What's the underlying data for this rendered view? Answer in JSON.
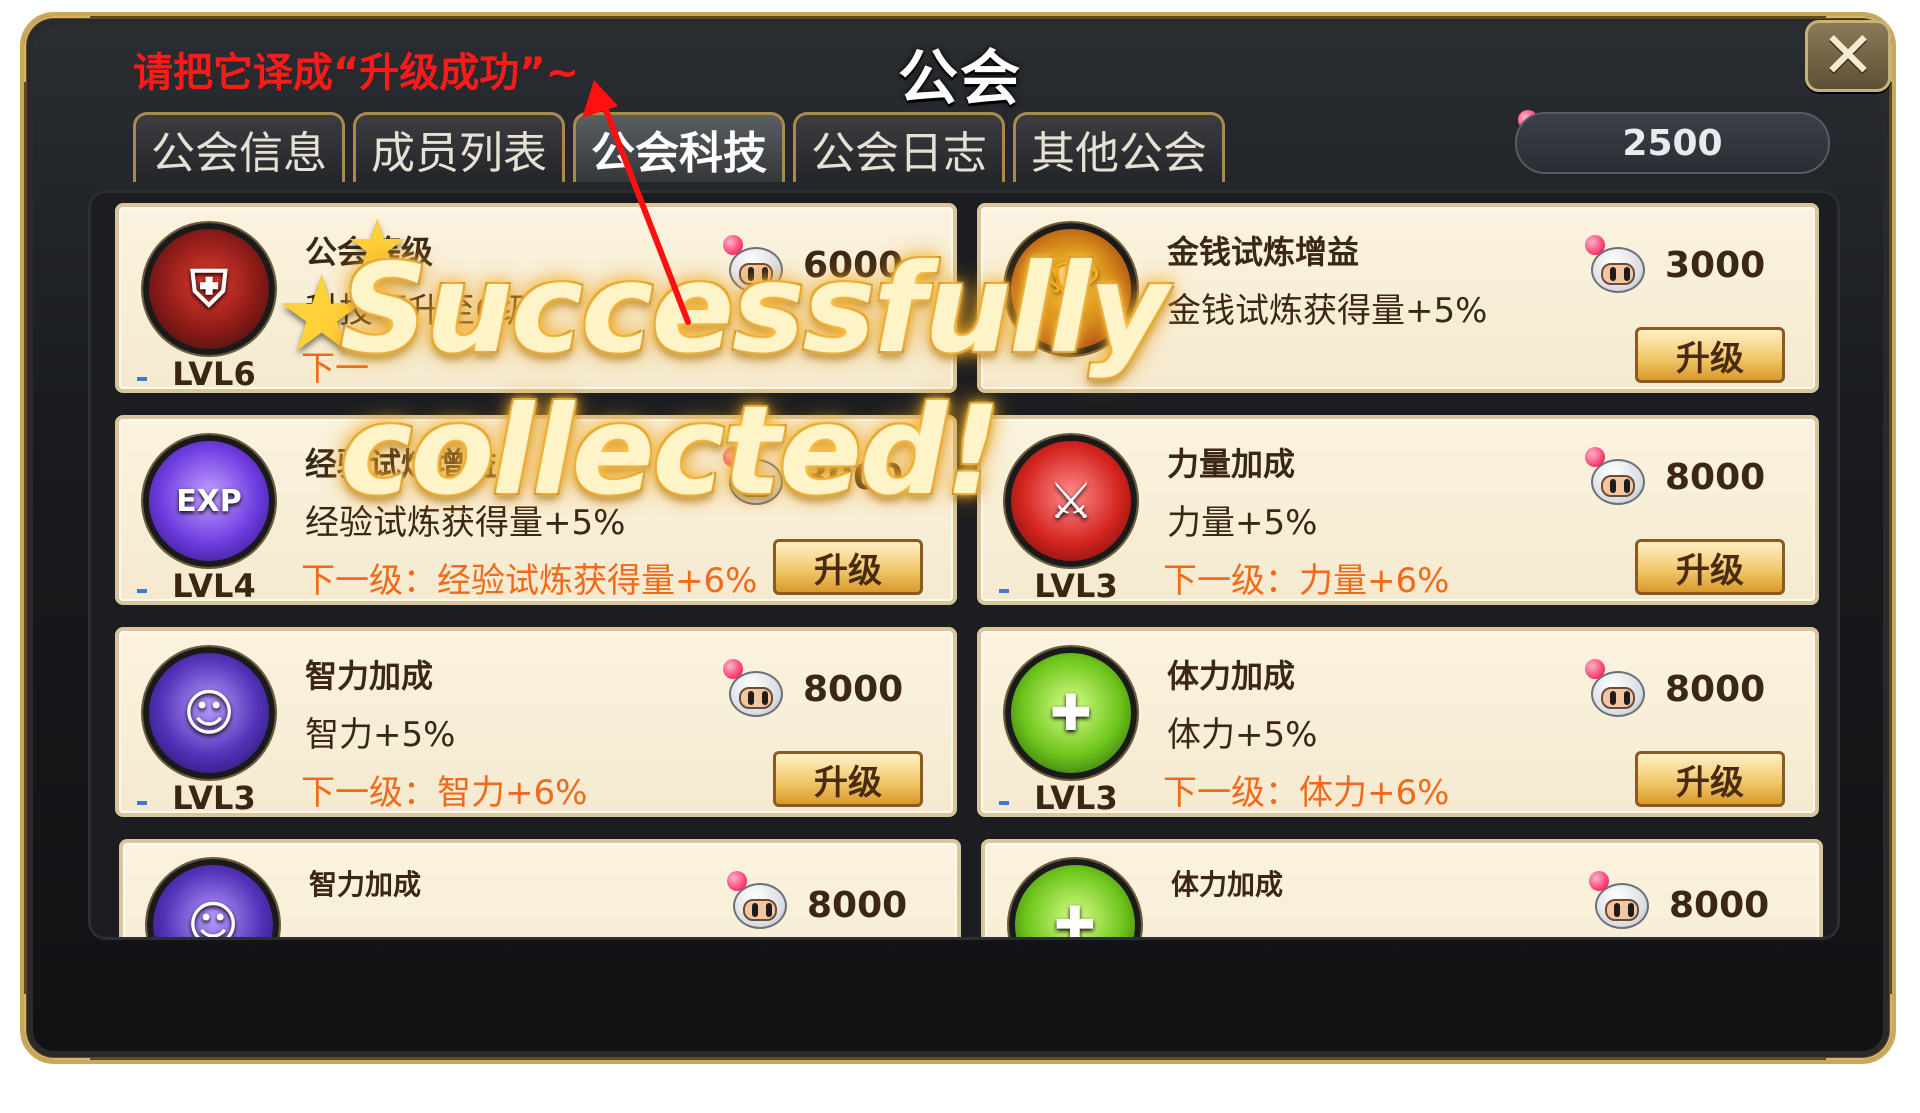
{
  "window": {
    "title": "公会",
    "annotation": "请把它译成“升级成功”~"
  },
  "tabs": [
    {
      "label": "公会信息",
      "active": false
    },
    {
      "label": "成员列表",
      "active": false
    },
    {
      "label": "公会科技",
      "active": true
    },
    {
      "label": "公会日志",
      "active": false
    },
    {
      "label": "其他公会",
      "active": false
    }
  ],
  "currency": {
    "amount": "2500",
    "icon": "bomber-coin-icon"
  },
  "overlay": {
    "text": "Successfully collected!"
  },
  "tech": [
    {
      "name": "公会等级",
      "desc": "科技可升至6级",
      "next": "下一",
      "level": "LVL6",
      "cost": "6000",
      "button": "",
      "icon": "guild-badge-icon"
    },
    {
      "name": "金钱试炼增益",
      "desc": "金钱试炼获得量+5%",
      "next": "",
      "level": "",
      "cost": "3000",
      "button": "升级",
      "icon": "gold-trophy-icon"
    },
    {
      "name": "经验试炼增益",
      "desc": "经验试炼获得量+5%",
      "next": "下一级：经验试炼获得量+6%",
      "level": "LVL4",
      "cost": "3000",
      "button": "升级",
      "icon": "exp-up-icon"
    },
    {
      "name": "力量加成",
      "desc": "力量+5%",
      "next": "下一级：力量+6%",
      "level": "LVL3",
      "cost": "8000",
      "button": "升级",
      "icon": "power-sword-icon"
    },
    {
      "name": "智力加成",
      "desc": "智力+5%",
      "next": "下一级：智力+6%",
      "level": "LVL3",
      "cost": "8000",
      "button": "升级",
      "icon": "intellect-icon"
    },
    {
      "name": "体力加成",
      "desc": "体力+5%",
      "next": "下一级：体力+6%",
      "level": "LVL3",
      "cost": "8000",
      "button": "升级",
      "icon": "vitality-cross-icon"
    },
    {
      "name": "智力加成",
      "desc": "",
      "next": "",
      "level": "",
      "cost": "8000",
      "button": "",
      "icon": "intellect-icon"
    },
    {
      "name": "体力加成",
      "desc": "",
      "next": "",
      "level": "",
      "cost": "8000",
      "button": "",
      "icon": "vitality-cross-icon"
    }
  ],
  "glyphs": {
    "exp": "EXP",
    "close": "✕"
  }
}
